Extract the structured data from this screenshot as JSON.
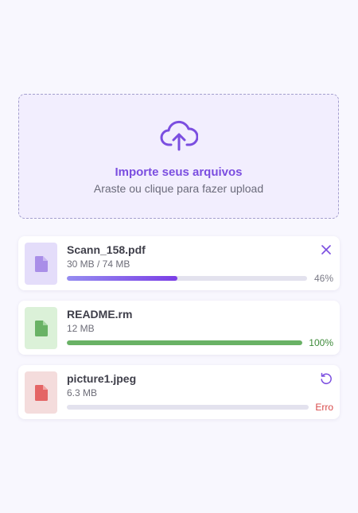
{
  "upload": {
    "title": "Importe seus arquivos",
    "subtitle": "Araste ou clique para fazer upload",
    "icon": "cloud-upload-icon",
    "accent_color": "#7b4ee0"
  },
  "files": [
    {
      "name": "Scann_158.pdf",
      "size": "30 MB / 74 MB",
      "progress": 0.46,
      "status_text": "46%",
      "status": "uploading",
      "action": "cancel",
      "thumb_bg": "#e4ddfa",
      "icon_color": "#a98ee8",
      "bar_color": "#7b4ee0",
      "status_color": "#7a7a86"
    },
    {
      "name": "README.rm",
      "size": "12 MB",
      "progress": 1.0,
      "status_text": "100%",
      "status": "complete",
      "action": "none",
      "thumb_bg": "#dbf1d8",
      "icon_color": "#69b265",
      "bar_color": "#69b265",
      "status_color": "#3e8a3a"
    },
    {
      "name": "picture1.jpeg",
      "size": "6.3 MB",
      "progress": 0,
      "status_text": "Erro",
      "status": "error",
      "action": "retry",
      "thumb_bg": "#f4dcdc",
      "icon_color": "#e46565",
      "bar_color": "#e3e2ee",
      "status_color": "#d84a4a"
    }
  ]
}
